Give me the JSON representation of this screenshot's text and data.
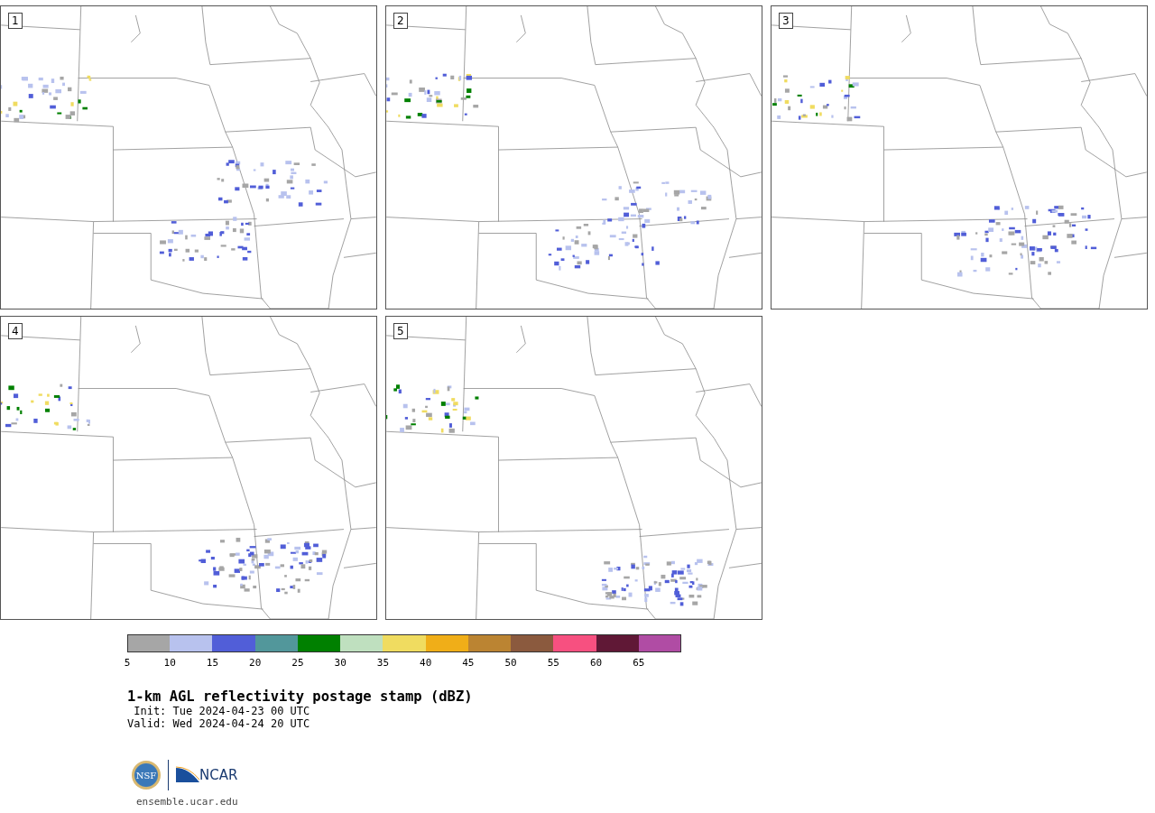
{
  "panels": [
    {
      "label": "1"
    },
    {
      "label": "2"
    },
    {
      "label": "3"
    },
    {
      "label": "4"
    },
    {
      "label": "5"
    }
  ],
  "colorbar": {
    "bins": [
      {
        "color": "#a6a6a6",
        "tick": "5"
      },
      {
        "color": "#b8c2ee",
        "tick": "10"
      },
      {
        "color": "#515ed8",
        "tick": "15"
      },
      {
        "color": "#52979b",
        "tick": "20"
      },
      {
        "color": "#008000",
        "tick": "25"
      },
      {
        "color": "#bfe0bf",
        "tick": "30"
      },
      {
        "color": "#f0dc60",
        "tick": "35"
      },
      {
        "color": "#f0ae18",
        "tick": "40"
      },
      {
        "color": "#bb8432",
        "tick": "45"
      },
      {
        "color": "#8b5a3e",
        "tick": "50"
      },
      {
        "color": "#f75080",
        "tick": "55"
      },
      {
        "color": "#601836",
        "tick": "60"
      },
      {
        "color": "#b04ca4",
        "tick": "65"
      }
    ]
  },
  "title": "1-km AGL reflectivity postage stamp (dBZ)",
  "init": " Init: Tue 2024-04-23 00 UTC",
  "valid": "Valid: Wed 2024-04-24 20 UTC",
  "logos": {
    "nsf": "NSF",
    "ncar": "NCAR"
  },
  "url": "ensemble.ucar.edu"
}
